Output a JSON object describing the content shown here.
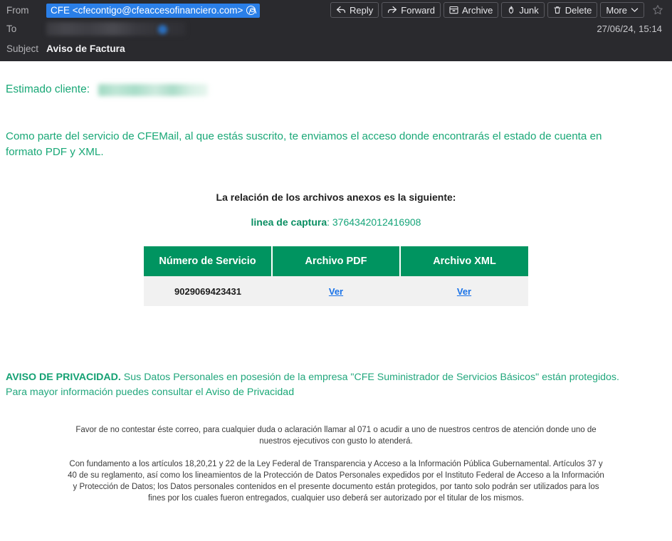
{
  "header": {
    "from_label": "From",
    "from_value": "CFE <cfecontigo@cfeaccesofinanciero.com>",
    "from_contact_icon": "contact-icon",
    "to_label": "To",
    "to_value": "",
    "subject_label": "Subject",
    "subject_value": "Aviso de Factura",
    "date": "27/06/24, 15:14",
    "accent_selection": "#2a7fe8",
    "background": "#2a2a2e"
  },
  "toolbar": {
    "buttons": [
      {
        "label": "Reply",
        "icon": "reply-icon"
      },
      {
        "label": "Forward",
        "icon": "forward-icon"
      },
      {
        "label": "Archive",
        "icon": "archive-box-icon"
      },
      {
        "label": "Junk",
        "icon": "flame-icon"
      },
      {
        "label": "Delete",
        "icon": "trash-icon"
      },
      {
        "label": "More",
        "icon": "chevron-down-icon"
      }
    ],
    "star_icon": "star-outline-icon"
  },
  "body": {
    "greeting": "Estimado cliente:",
    "paragraph": "Como parte del servicio de CFEMail, al que estás suscrito, te enviamos el acceso donde encontrarás el estado de cuenta en formato PDF y XML.",
    "anexos_title": "La relación de los archivos anexos es la siguiente:",
    "captura_label": "linea de captura",
    "captura_separator": ": ",
    "captura_value": "3764342012416908",
    "text_color": "#1aa877"
  },
  "files_table": {
    "header_color": "#009460",
    "row_color": "#f1f1f1",
    "link_color": "#1a73e8",
    "columns": [
      "Número de Servicio",
      "Archivo PDF",
      "Archivo XML"
    ],
    "rows": [
      {
        "servicio": "9029069423431",
        "pdf_link": "Ver",
        "xml_link": "Ver"
      }
    ]
  },
  "privacy": {
    "lead": "AVISO DE PRIVACIDAD.",
    "text": " Sus Datos Personales en posesión de la empresa \"CFE Suministrador de Servicios Básicos\" están protegidos. Para mayor información puedes consultar el ",
    "link": "Aviso de Privacidad"
  },
  "fineprint": {
    "paragraph1": "Favor de no contestar éste correo, para cualquier duda o aclaración llamar al 071 o acudir a uno de nuestros centros de atención donde uno de nuestros ejecutivos con gusto lo atenderá.",
    "paragraph2": "Con fundamento a los artículos 18,20,21 y 22 de la Ley Federal de Transparencia y Acceso a la Información Pública Gubernamental. Artículos 37 y 40 de su reglamento, así como los lineamientos de la Protección de Datos Personales expedidos por el Instituto Federal de Acceso a la Información y Protección de Datos; los Datos personales contenidos en el presente documento están protegidos, por tanto solo podrán ser utilizados para los fines por los cuales fueron entregados, cualquier uso deberá ser autorizado por el titular de los mismos."
  }
}
